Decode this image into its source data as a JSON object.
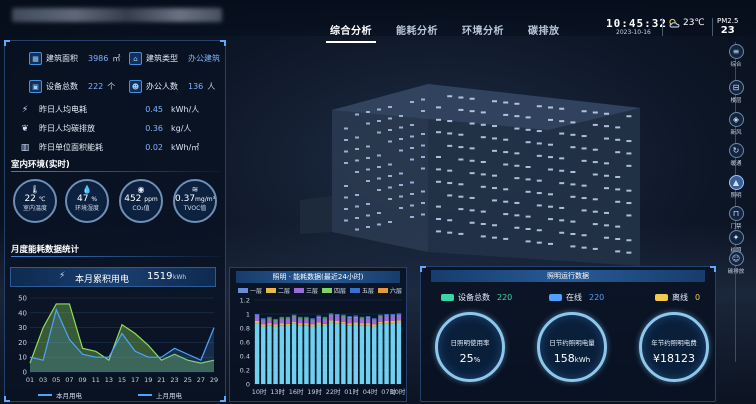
{
  "header": {
    "tabs": [
      {
        "label": "综合分析",
        "active": true
      },
      {
        "label": "能耗分析",
        "active": false
      },
      {
        "label": "环境分析",
        "active": false
      },
      {
        "label": "碳排放",
        "active": false
      }
    ],
    "time": "10:45:32",
    "date": "2023-10-16",
    "temperature": "23℃",
    "weather_icon": "partly-cloudy-icon",
    "pm_label": "PM2.5",
    "pm_value": "23"
  },
  "building_info": {
    "area_label": "建筑面积",
    "area_value": "3986",
    "area_unit": "㎡",
    "type_label": "建筑类型",
    "type_value": "办公建筑",
    "devices_label": "设备总数",
    "devices_value": "222",
    "devices_unit": "个",
    "staff_label": "办公人数",
    "staff_value": "136",
    "staff_unit": "人"
  },
  "daily_stats": [
    {
      "icon": "power-icon",
      "label": "昨日人均电耗",
      "value": "0.45",
      "unit": "kWh/人"
    },
    {
      "icon": "leaf-icon",
      "label": "昨日人均碳排放",
      "value": "0.36",
      "unit": "kg/人"
    },
    {
      "icon": "building-icon",
      "label": "昨日单位面积能耗",
      "value": "0.02",
      "unit": "kWh/㎡"
    }
  ],
  "indoor_env": {
    "title": "室内环境(实时)",
    "gauges": [
      {
        "icon": "thermometer-icon",
        "value": "22",
        "unit": "℃",
        "label": "室内温度"
      },
      {
        "icon": "droplet-icon",
        "value": "47",
        "unit": "%",
        "label": "环境湿度"
      },
      {
        "icon": "co2-icon",
        "value": "452",
        "unit": "ppm",
        "label": "CO₂值"
      },
      {
        "icon": "tvoc-icon",
        "value": "0.37",
        "unit": "mg/m³",
        "label": "TVOC值"
      }
    ]
  },
  "monthly": {
    "title": "月度能耗数据统计",
    "total_label": "本月累积用电",
    "total_value": "1519",
    "total_unit": "kWh",
    "legend_this": "本月用电",
    "legend_last": "上月用电",
    "color_this": "#4fa3ff",
    "color_last": "#8fdc5a"
  },
  "monthly_chart": {
    "type": "line",
    "x": [
      "01",
      "03",
      "05",
      "07",
      "09",
      "11",
      "13",
      "15",
      "17",
      "19",
      "21",
      "23",
      "25",
      "27",
      "29"
    ],
    "series": [
      {
        "name": "本月用电",
        "values": [
          10,
          8,
          42,
          22,
          12,
          10,
          10,
          26,
          14,
          10,
          10,
          16,
          12,
          8,
          30
        ]
      },
      {
        "name": "上月用电",
        "values": [
          6,
          30,
          46,
          46,
          16,
          14,
          8,
          32,
          26,
          18,
          8,
          12,
          8,
          6,
          8
        ]
      }
    ],
    "ylim": [
      0,
      50
    ],
    "yticks": [
      0,
      10,
      20,
      30,
      40,
      50
    ]
  },
  "lighting_chart_panel": {
    "title": "照明 · 能耗数据(最近24小时)"
  },
  "chart_data": {
    "type": "bar",
    "stacked": true,
    "ylim": [
      0,
      1.2
    ],
    "yticks": [
      0,
      0.2,
      0.4,
      0.6,
      0.8,
      1,
      1.2
    ],
    "categories": [
      "10时",
      "11时",
      "12时",
      "13时",
      "14时",
      "15时",
      "16时",
      "17时",
      "18时",
      "19时",
      "20时",
      "21时",
      "22时",
      "23时",
      "00时",
      "01时",
      "02时",
      "03时",
      "04时",
      "05时",
      "06时",
      "07时",
      "08时",
      "09时"
    ],
    "xtick_labels": [
      "10时",
      "13时",
      "16时",
      "19时",
      "22时",
      "01时",
      "04时",
      "07时",
      "10时"
    ],
    "series": [
      {
        "name": "一层",
        "color": "#6a8bd8",
        "values": [
          0.87,
          0.82,
          0.84,
          0.82,
          0.84,
          0.83,
          0.86,
          0.84,
          0.84,
          0.82,
          0.85,
          0.83,
          0.88,
          0.87,
          0.86,
          0.84,
          0.85,
          0.84,
          0.84,
          0.82,
          0.86,
          0.87,
          0.87,
          0.88
        ]
      },
      {
        "name": "二层",
        "color": "#e8b84a",
        "values": [
          0.03,
          0.03,
          0.03,
          0.03,
          0.03,
          0.03,
          0.03,
          0.03,
          0.03,
          0.03,
          0.03,
          0.03,
          0.03,
          0.03,
          0.03,
          0.03,
          0.03,
          0.03,
          0.03,
          0.03,
          0.03,
          0.03,
          0.03,
          0.03
        ]
      },
      {
        "name": "三层",
        "color": "#9b6cd9",
        "values": [
          0.07,
          0.06,
          0.06,
          0.05,
          0.06,
          0.07,
          0.07,
          0.06,
          0.06,
          0.06,
          0.07,
          0.07,
          0.07,
          0.07,
          0.07,
          0.07,
          0.07,
          0.06,
          0.07,
          0.06,
          0.07,
          0.07,
          0.07,
          0.07
        ]
      },
      {
        "name": "四层",
        "color": "#7dd36b",
        "values": [
          0.01,
          0.01,
          0.01,
          0.01,
          0.01,
          0.01,
          0.01,
          0.01,
          0.01,
          0.01,
          0.01,
          0.01,
          0.01,
          0.01,
          0.01,
          0.01,
          0.01,
          0.01,
          0.01,
          0.01,
          0.01,
          0.01,
          0.01,
          0.01
        ]
      },
      {
        "name": "五层",
        "color": "#3a70d0",
        "values": [
          0.02,
          0.02,
          0.02,
          0.02,
          0.02,
          0.02,
          0.02,
          0.02,
          0.02,
          0.02,
          0.02,
          0.02,
          0.02,
          0.02,
          0.02,
          0.02,
          0.02,
          0.02,
          0.02,
          0.02,
          0.02,
          0.02,
          0.02,
          0.02
        ]
      },
      {
        "name": "六层",
        "color": "#e39a3c",
        "values": [
          0.0,
          0.0,
          0.0,
          0.0,
          0.0,
          0.0,
          0.0,
          0.0,
          0.0,
          0.0,
          0.0,
          0.0,
          0.0,
          0.0,
          0.0,
          0.0,
          0.0,
          0.0,
          0.0,
          0.0,
          0.0,
          0.0,
          0.0,
          0.0
        ]
      }
    ],
    "base_color": "#6fd0f0",
    "top_color": "#7f55c9"
  },
  "lighting_status": {
    "title": "照明运行数据",
    "devices_label": "设备总数",
    "devices_value": "220",
    "devices_color": "#3bd6a7",
    "online_label": "在线",
    "online_value": "220",
    "online_color": "#4ea0ff",
    "offline_label": "离线",
    "offline_value": "0",
    "offline_color": "#f2c94c",
    "rings": [
      {
        "label": "日照明使用率",
        "value": "25",
        "unit": "%"
      },
      {
        "label": "日节约照明电量",
        "value": "158",
        "unit": "kWh"
      },
      {
        "label": "年节约照明电费",
        "value": "¥18123",
        "unit": ""
      }
    ]
  },
  "toolbar": {
    "items": [
      {
        "icon": "layers-icon",
        "label": "综合",
        "active": false
      },
      {
        "icon": "road-icon",
        "label": "楼层",
        "active": false
      },
      {
        "icon": "cube-icon",
        "label": "新风",
        "active": false
      },
      {
        "icon": "cycle-icon",
        "label": "暖通",
        "active": false
      },
      {
        "icon": "lamp-icon",
        "label": "照明",
        "active": true
      },
      {
        "icon": "door-icon",
        "label": "门禁",
        "active": false
      },
      {
        "icon": "bulb-icon",
        "label": "给照",
        "active": false
      },
      {
        "icon": "person-icon",
        "label": "碳排放",
        "active": false
      }
    ]
  }
}
